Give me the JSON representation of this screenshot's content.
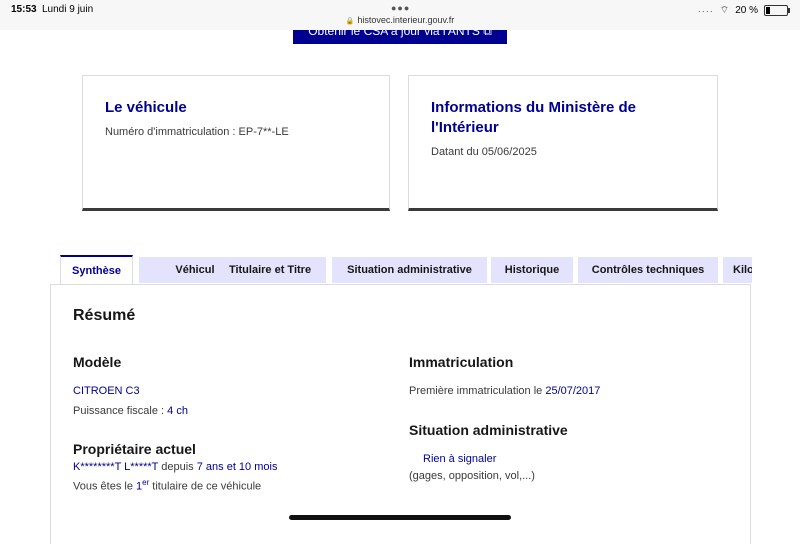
{
  "status_bar": {
    "time": "15:53",
    "date": "Lundi 9 juin",
    "url": "histovec.interieur.gouv.fr",
    "battery": "20 %",
    "battery_level": 0.2
  },
  "top_button": {
    "label": "Obtenir le CSA à jour via l'ANTS ⧉"
  },
  "card_vehicle": {
    "title": "Le véhicule",
    "subtitle": "Numéro d'immatriculation : EP-7**-LE"
  },
  "card_ministry": {
    "title": "Informations du Ministère de l'Intérieur",
    "subtitle": "Datant du 05/06/2025"
  },
  "tabs": [
    {
      "label": "Synthèse"
    },
    {
      "label": "Véhicule"
    },
    {
      "label": "Titulaire et Titre"
    },
    {
      "label": "Situation administrative"
    },
    {
      "label": "Historique"
    },
    {
      "label": "Contrôles techniques"
    },
    {
      "label": "Kilo"
    }
  ],
  "summary": {
    "title": "Résumé",
    "model": {
      "title": "Modèle",
      "name": "CITROEN C3",
      "power_label": "Puissance fiscale : ",
      "power_value": "4 ch"
    },
    "owner": {
      "title": "Propriétaire actuel",
      "name": "K********T L*****T",
      "since_label": " depuis ",
      "since_value": "7 ans et 10 mois",
      "rank_prefix": "Vous êtes le ",
      "rank_number": "1",
      "rank_suffix": "er",
      "rank_tail": " titulaire de ce véhicule"
    },
    "registration": {
      "title": "Immatriculation",
      "first_label": "Première immatriculation le ",
      "first_date": "25/07/2017"
    },
    "admin": {
      "title": "Situation administrative",
      "status": "Rien à signaler",
      "detail": "(gages, opposition, vol,...)"
    }
  }
}
